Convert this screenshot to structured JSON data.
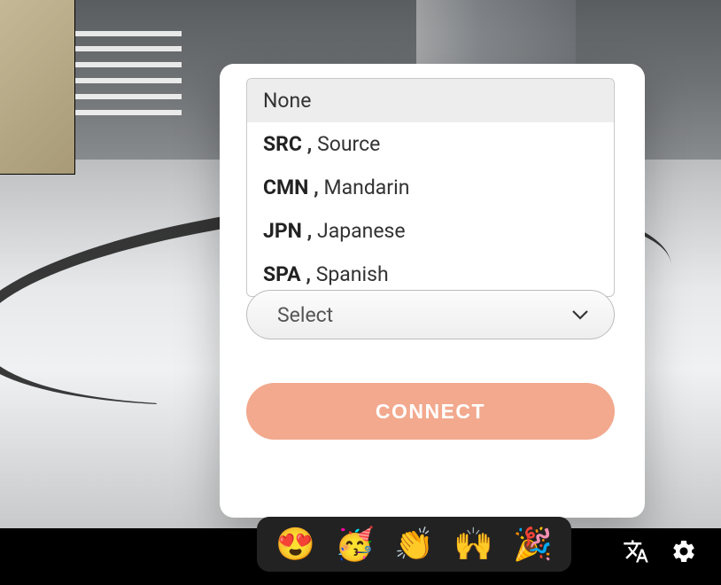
{
  "dropdown": {
    "options": [
      {
        "code": "",
        "label": "None",
        "selected": true
      },
      {
        "code": "SRC",
        "label": "Source",
        "selected": false
      },
      {
        "code": "CMN",
        "label": "Mandarin",
        "selected": false
      },
      {
        "code": "JPN",
        "label": "Japanese",
        "selected": false
      },
      {
        "code": "SPA",
        "label": "Spanish",
        "selected": false
      }
    ]
  },
  "select": {
    "placeholder": "Select"
  },
  "buttons": {
    "connect_label": "CONNECT"
  },
  "reactions": {
    "items": [
      {
        "emoji": "😍",
        "name": "heart-eyes"
      },
      {
        "emoji": "🥳",
        "name": "party-face"
      },
      {
        "emoji": "👏",
        "name": "clap"
      },
      {
        "emoji": "🙌",
        "name": "raised-hands"
      },
      {
        "emoji": "🎉",
        "name": "confetti"
      }
    ]
  }
}
